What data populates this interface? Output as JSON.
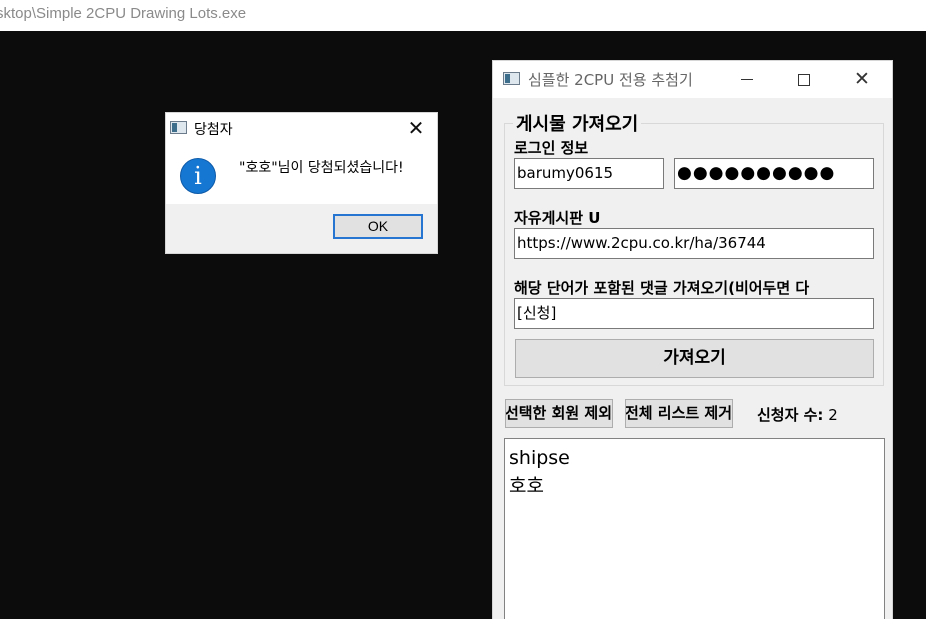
{
  "path_bar": {
    "text": "sktop\\Simple 2CPU Drawing Lots.exe"
  },
  "message_box": {
    "title": "당첨자",
    "message": "\"호호\"님이 당첨되셨습니다!",
    "ok_label": "OK",
    "close_glyph": "✕",
    "icon_glyph": "i"
  },
  "main_window": {
    "title": "심플한 2CPU 전용 추첨기",
    "caption": {
      "close_glyph": "✕"
    },
    "group_title": "게시물 가져오기",
    "login_label": "로그인 정보",
    "username_value": "barumy0615",
    "password_value": "●●●●●●●●●●",
    "board_label": "자유게시판 U",
    "url_value": "https://www.2cpu.co.kr/ha/36744",
    "keyword_label": "해당 단어가 포함된 댓글 가져오기(비어두면 다",
    "keyword_value": "[신청]",
    "fetch_button": "가져오기",
    "remove_selected_button": "선택한 회원 제외",
    "remove_all_button": "전체 리스트 제거",
    "applicant_count_label": "신청자 수:",
    "applicant_count": "2",
    "applicants": [
      "shipse",
      "호호"
    ]
  }
}
